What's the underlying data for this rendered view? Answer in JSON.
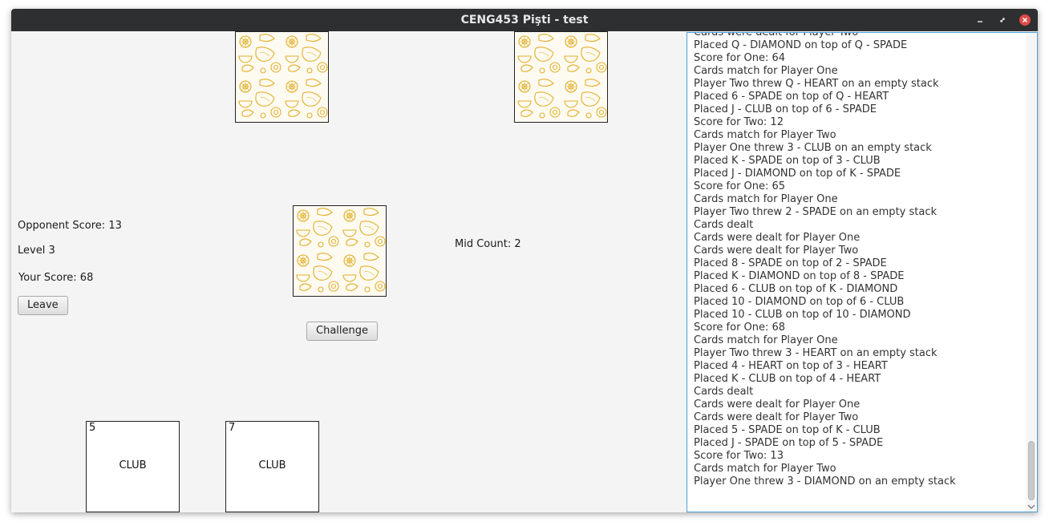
{
  "window": {
    "title": "CENG453 Pişti - test"
  },
  "game": {
    "opponent_score_label": "Opponent Score: 13",
    "level_label": "Level 3",
    "your_score_label": "Your Score: 68",
    "mid_count_label": "Mid Count: 2",
    "leave_label": "Leave",
    "challenge_label": "Challenge"
  },
  "hand": [
    {
      "rank": "5",
      "suit": "CLUB"
    },
    {
      "rank": "7",
      "suit": "CLUB"
    }
  ],
  "log": [
    "Cards were dealt for Player Two",
    "Placed Q - DIAMOND on top of Q - SPADE",
    "Score for One: 64",
    "Cards match for Player One",
    "Player Two threw Q - HEART on an empty stack",
    "Placed 6 - SPADE on top of Q - HEART",
    "Placed J - CLUB on top of 6 - SPADE",
    "Score for Two: 12",
    "Cards match for Player Two",
    "Player One threw 3 - CLUB on an empty stack",
    "Placed K - SPADE on top of 3 - CLUB",
    "Placed J - DIAMOND on top of K - SPADE",
    "Score for One: 65",
    "Cards match for Player One",
    "Player Two threw 2 - SPADE on an empty stack",
    "Cards dealt",
    "Cards were dealt for Player One",
    "Cards were dealt for Player Two",
    "Placed 8 - SPADE on top of 2 - SPADE",
    "Placed K - DIAMOND on top of 8 - SPADE",
    "Placed 6 - CLUB on top of K - DIAMOND",
    "Placed 10 - DIAMOND on top of 6 - CLUB",
    "Placed 10 - CLUB on top of 10 - DIAMOND",
    "Score for One: 68",
    "Cards match for Player One",
    "Player Two threw 3 - HEART on an empty stack",
    "Placed 4 - HEART on top of 3 - HEART",
    "Placed K - CLUB on top of 4 - HEART",
    "Cards dealt",
    "Cards were dealt for Player One",
    "Cards were dealt for Player Two",
    "Placed 5 - SPADE on top of K - CLUB",
    "Placed J - SPADE on top of 5 - SPADE",
    "Score for Two: 13",
    "Cards match for Player Two",
    "Player One threw 3 - DIAMOND on an empty stack"
  ],
  "colors": {
    "card_pattern": "#e3b02a",
    "log_border": "#4a9fd8",
    "close_button": "#e04a4a"
  },
  "icons": [
    "minimize-icon",
    "maximize-icon",
    "close-icon",
    "lemon-pattern",
    "scroll-down-icon"
  ]
}
